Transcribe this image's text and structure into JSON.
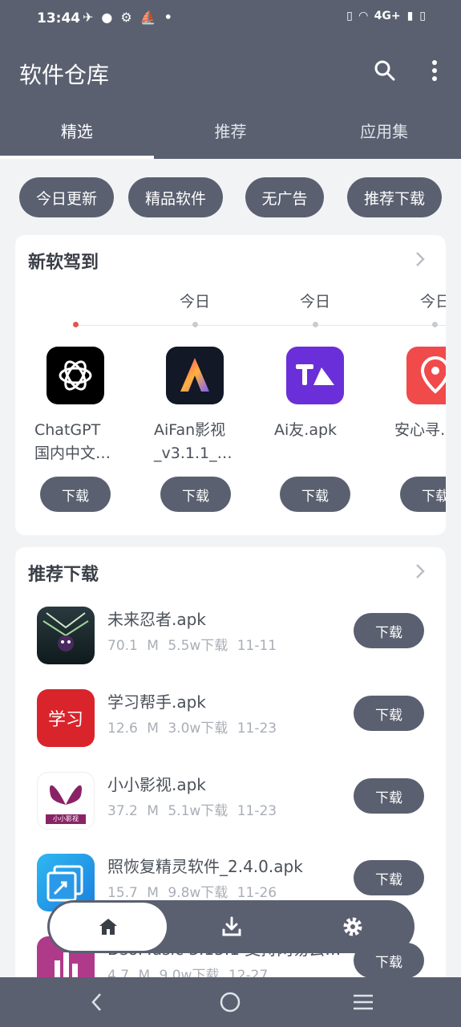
{
  "status": {
    "time": "13:44",
    "network": "4G+"
  },
  "header": {
    "title": "软件仓库"
  },
  "tabs": [
    {
      "label": "精选"
    },
    {
      "label": "推荐"
    },
    {
      "label": "应用集"
    }
  ],
  "chips": [
    {
      "label": "今日更新"
    },
    {
      "label": "精品软件"
    },
    {
      "label": "无广告"
    },
    {
      "label": "推荐下载"
    }
  ],
  "new_arrivals": {
    "title": "新软驾到",
    "timeline_labels": [
      "",
      "今日",
      "今日",
      "今日"
    ],
    "apps": [
      {
        "name_line1": "ChatGPT",
        "name_line2": "国内中文…",
        "button": "下载"
      },
      {
        "name_line1": "AiFan影视",
        "name_line2": "_v3.1.1_…",
        "button": "下载"
      },
      {
        "name_line1": "Ai友.apk",
        "name_line2": "",
        "button": "下载"
      },
      {
        "name_line1": "安心寻…",
        "name_line2": "",
        "button": "下载"
      }
    ]
  },
  "recommended": {
    "title": "推荐下载",
    "items": [
      {
        "name": "未来忍者.apk",
        "size": "70.1 M",
        "downloads": "5.5w下载",
        "date": "11-11",
        "button": "下载"
      },
      {
        "name": "学习帮手.apk",
        "size": "12.6 M",
        "downloads": "3.0w下载",
        "date": "11-23",
        "button": "下载",
        "icon_text": "学习"
      },
      {
        "name": "小小影视.apk",
        "size": "37.2 M",
        "downloads": "5.1w下载",
        "date": "11-23",
        "button": "下载",
        "icon_text": "小小影视"
      },
      {
        "name": "照恢复精灵软件_2.4.0.apk",
        "size": "15.7 M",
        "downloads": "9.8w下载",
        "date": "11-26",
        "button": "下载"
      },
      {
        "name": "DsoMusic 3.13.1 支持网易云…",
        "size": "4.7 M",
        "downloads": "9.0w下载",
        "date": "12-27",
        "button": "下载"
      }
    ]
  },
  "colors": {
    "primary": "#5a6070",
    "accent_dot": "#e0574b",
    "background": "#f2f3f5"
  }
}
